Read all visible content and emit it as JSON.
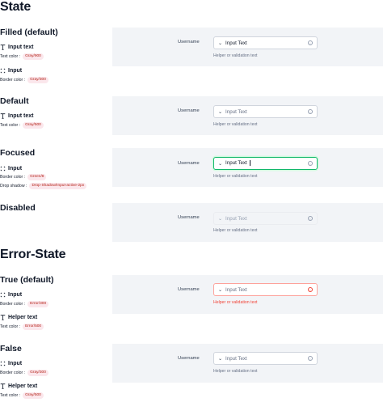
{
  "sections": {
    "state_title": "State",
    "error_state_title": "Error-State"
  },
  "groups": {
    "filled": {
      "title": "Filled (default)",
      "specs": [
        {
          "name": "Input text",
          "prop": "Text color :",
          "value": "Gray/900"
        },
        {
          "name": "Input",
          "prop": "Border color :",
          "value": "Gray/300"
        }
      ]
    },
    "default": {
      "title": "Default",
      "specs": [
        {
          "name": "Input text",
          "prop": "Text color :",
          "value": "Gray/500"
        }
      ]
    },
    "focused": {
      "title": "Focused",
      "specs": [
        {
          "name": "Input",
          "prop": "Border color :",
          "value": "Green/8",
          "prop2": "Drop shadow :",
          "value2": "Drop-Shadow/Input-active-2px"
        }
      ]
    },
    "disabled": {
      "title": "Disabled"
    },
    "true_default": {
      "title": "True (default)",
      "specs": [
        {
          "name": "Input",
          "prop": "Border color :",
          "value": "Error/300"
        },
        {
          "name": "Helper text",
          "prop": "Text color :",
          "value": "Error/500"
        }
      ]
    },
    "false": {
      "title": "False",
      "specs": [
        {
          "name": "Input",
          "prop": "Border color :",
          "value": "Gray/300"
        },
        {
          "name": "Helper text",
          "prop": "Text color :",
          "value": "Gray/500"
        }
      ]
    }
  },
  "field": {
    "label": "Username",
    "value": "Input Text",
    "helper": "Helper or validation text",
    "info_glyph": "i",
    "chevron_glyph": "⌄"
  },
  "colors": {
    "pill_bg": "#fbe7ec",
    "pill_text": "#b42318",
    "panel_bg": "#f2f4f7",
    "focus_border": "#12b76a",
    "error_border": "#fda29b",
    "error_text": "#f04438"
  }
}
